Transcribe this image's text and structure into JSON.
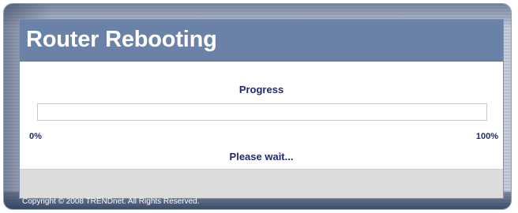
{
  "header": {
    "title": "Router Rebooting"
  },
  "progress": {
    "label": "Progress",
    "start_label": "0%",
    "end_label": "100%",
    "percent": 0,
    "fill_color": "#6a82a8"
  },
  "status": {
    "message": "Please wait..."
  },
  "footer": {
    "copyright": "Copyright © 2008 TRENDnet. All Rights Reserved."
  },
  "colors": {
    "header_bg": "#6a82a8",
    "text_primary": "#1f2a6e",
    "footer_bar": "#dcdcdc"
  }
}
